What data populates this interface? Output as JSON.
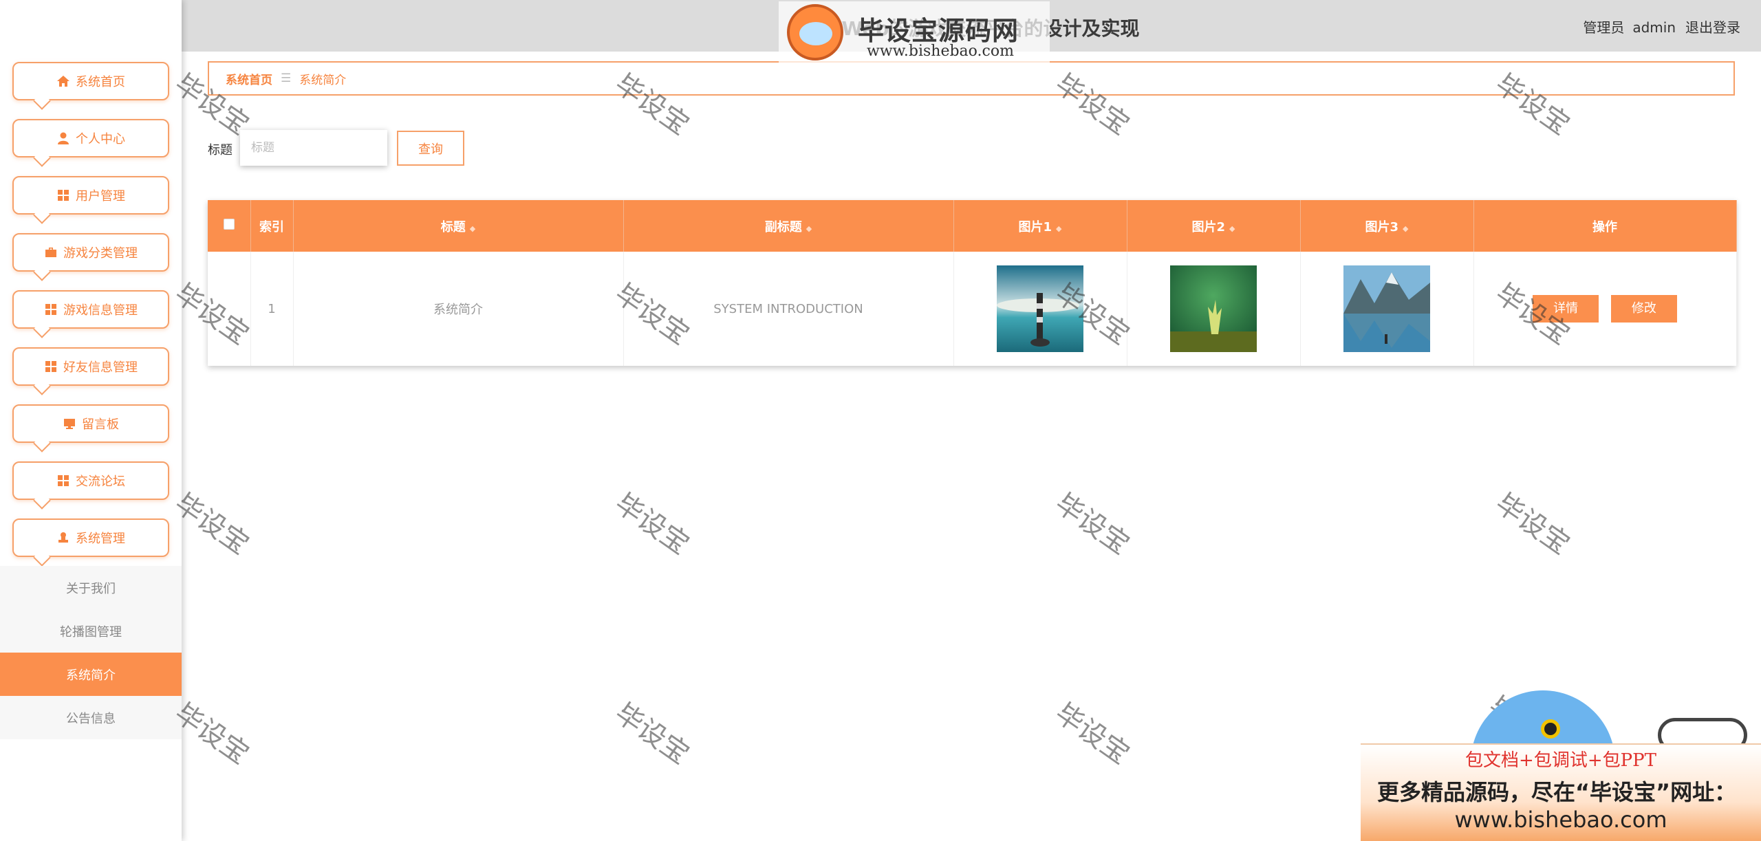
{
  "header": {
    "title": "基于Web的游戏交流平台的设计及实现",
    "role": "管理员",
    "username": "admin",
    "logout_label": "退出登录"
  },
  "logo": {
    "text": "毕设宝源码网",
    "url": "www.bishebao.com"
  },
  "sidebar": {
    "items": [
      {
        "label": "系统首页",
        "icon": "home-icon"
      },
      {
        "label": "个人中心",
        "icon": "user-icon"
      },
      {
        "label": "用户管理",
        "icon": "grid-icon"
      },
      {
        "label": "游戏分类管理",
        "icon": "briefcase-icon"
      },
      {
        "label": "游戏信息管理",
        "icon": "grid-icon"
      },
      {
        "label": "好友信息管理",
        "icon": "grid-icon"
      },
      {
        "label": "留言板",
        "icon": "monitor-icon"
      },
      {
        "label": "交流论坛",
        "icon": "grid-icon"
      },
      {
        "label": "系统管理",
        "icon": "user-stamp-icon"
      }
    ],
    "submenu": [
      {
        "label": "关于我们",
        "active": false
      },
      {
        "label": "轮播图管理",
        "active": false
      },
      {
        "label": "系统简介",
        "active": true
      },
      {
        "label": "公告信息",
        "active": false
      }
    ]
  },
  "breadcrumb": {
    "home": "系统首页",
    "separator": "☰",
    "current": "系统简介"
  },
  "search": {
    "label": "标题",
    "placeholder": "标题",
    "value": "",
    "button_label": "查询"
  },
  "table": {
    "headers": {
      "index": "索引",
      "title": "标题",
      "subtitle": "副标题",
      "image1": "图片1",
      "image2": "图片2",
      "image3": "图片3",
      "actions": "操作"
    },
    "rows": [
      {
        "index": "1",
        "title": "系统简介",
        "subtitle": "SYSTEM INTRODUCTION",
        "detail_label": "详情",
        "edit_label": "修改"
      }
    ]
  },
  "watermark": "毕设宝",
  "promo": {
    "line1": "包文档+包调试+包PPT",
    "line2": "更多精品源码，尽在“毕设宝”网址：",
    "line3": "www.bishebao.com"
  },
  "colors": {
    "accent": "#fb8f4d",
    "border": "#f6a069",
    "header_bg": "#dcdcdc"
  }
}
